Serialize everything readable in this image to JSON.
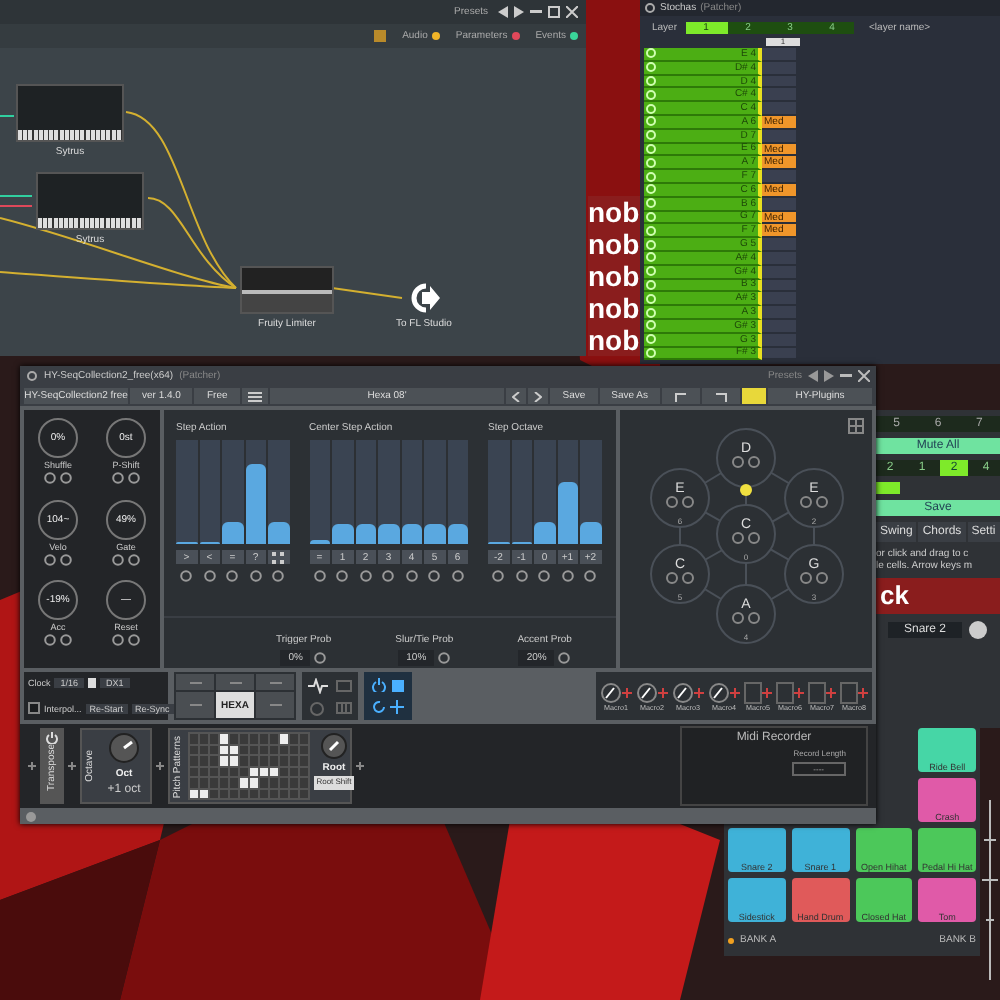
{
  "wallpaper": {
    "side_texts": [
      "nob",
      "nob",
      "nob",
      "nob",
      "nob"
    ]
  },
  "patcher": {
    "presets": "Presets",
    "legend": [
      {
        "label": "Audio",
        "color": "#f0b428"
      },
      {
        "label": "Parameters",
        "color": "#e0485a"
      },
      {
        "label": "Events",
        "color": "#3ad59a"
      }
    ],
    "nodes": [
      {
        "kind": "synth",
        "label": "Sytrus"
      },
      {
        "kind": "synth",
        "label": "Sytrus"
      },
      {
        "kind": "limiter",
        "label": "Fruity Limiter"
      },
      {
        "kind": "output",
        "label": "To FL Studio"
      }
    ]
  },
  "stochas": {
    "title": "Stochas",
    "subtitle": "(Patcher)",
    "layer_label": "Layer",
    "layer_name": "<layer name>",
    "column_header": "1",
    "layers": [
      {
        "label": "1",
        "selected": true
      },
      {
        "label": "2",
        "selected": false
      },
      {
        "label": "3",
        "selected": false
      },
      {
        "label": "4",
        "selected": false
      }
    ],
    "rows": [
      {
        "note": "E 4"
      },
      {
        "note": "D# 4"
      },
      {
        "note": "D 4"
      },
      {
        "note": "C# 4"
      },
      {
        "note": "C 4"
      },
      {
        "note": "A 6",
        "cell": "Med"
      },
      {
        "note": "D 7"
      },
      {
        "note": "E 6",
        "cell": "Med"
      },
      {
        "note": "A 7",
        "cell": "Med"
      },
      {
        "note": "F 7"
      },
      {
        "note": "C 6",
        "cell": "Med"
      },
      {
        "note": "B 6"
      },
      {
        "note": "G 7",
        "cell": "Med"
      },
      {
        "note": "F 7",
        "cell": "Med"
      },
      {
        "note": "G 5"
      },
      {
        "note": "A# 4"
      },
      {
        "note": "G# 4"
      },
      {
        "note": "B 3"
      },
      {
        "note": "A# 3"
      },
      {
        "note": "A 3"
      },
      {
        "note": "G# 3"
      },
      {
        "note": "G 3"
      },
      {
        "note": "F# 3"
      }
    ]
  },
  "drum": {
    "steps": [
      "5",
      "6",
      "7"
    ],
    "mute_all": "Mute All",
    "tabs": [
      {
        "label": "2",
        "selected": false
      },
      {
        "label": "1",
        "selected": false
      },
      {
        "label": "2",
        "selected": true
      },
      {
        "label": "4",
        "selected": false
      }
    ],
    "save": "Save",
    "menu": [
      "Swing",
      "Chords",
      "Setti"
    ],
    "hint": [
      "or click and drag to c",
      "le cells. Arrow keys m"
    ],
    "banner": "ck",
    "sound": "Snare 2",
    "pads": [
      {
        "label": "Ride Bell",
        "color": "#46d6a6"
      },
      {
        "label": "Crash",
        "color": "#e05aa8"
      },
      {
        "label": "Snare 2",
        "color": "#3fb2d8"
      },
      {
        "label": "Snare 1",
        "color": "#3fb2d8"
      },
      {
        "label": "Open Hihat",
        "color": "#4cc85a"
      },
      {
        "label": "Pedal Hi Hat",
        "color": "#4cc85a"
      },
      {
        "label": "Sidestick",
        "color": "#3fb2d8"
      },
      {
        "label": "Hand Drum",
        "color": "#e05a5a"
      },
      {
        "label": "Closed Hat",
        "color": "#4cc85a"
      },
      {
        "label": "Tom",
        "color": "#e05aa8"
      }
    ],
    "bank_a": "BANK A",
    "bank_b": "BANK B"
  },
  "plugin": {
    "title": "HY-SeqCollection2_free(x64)",
    "subtitle": "(Patcher)",
    "presets": "Presets",
    "toolbar": {
      "name": "HY-SeqCollection2 free",
      "version": "ver 1.4.0",
      "license": "Free",
      "preset": "Hexa 08'",
      "save": "Save",
      "save_as": "Save As",
      "brand": "HY-Plugins"
    },
    "knobs": [
      {
        "value": "0%",
        "label": "Shuffle"
      },
      {
        "value": "0st",
        "label": "P-Shift"
      },
      {
        "value": "104~",
        "label": "Velo"
      },
      {
        "value": "49%",
        "label": "Gate"
      },
      {
        "value": "-19%",
        "label": "Acc"
      },
      {
        "value": "—",
        "label": "Reset"
      }
    ],
    "groups": [
      {
        "title": "Step Action",
        "bars": [
          {
            "level": 0,
            "button": ">"
          },
          {
            "level": 0,
            "button": "<"
          },
          {
            "level": 0.22,
            "button": "="
          },
          {
            "level": 0.78,
            "button": "?"
          },
          {
            "level": 0.22,
            "kind": "icon"
          }
        ]
      },
      {
        "title": "Center Step Action",
        "bars": [
          {
            "level": 0.05,
            "button": "="
          },
          {
            "level": 0.2,
            "button": "1"
          },
          {
            "level": 0.2,
            "button": "2"
          },
          {
            "level": 0.2,
            "button": "3"
          },
          {
            "level": 0.2,
            "button": "4"
          },
          {
            "level": 0.2,
            "button": "5"
          },
          {
            "level": 0.2,
            "button": "6"
          }
        ]
      },
      {
        "title": "Step Octave",
        "bars": [
          {
            "level": 0,
            "button": "-2"
          },
          {
            "level": 0,
            "button": "-1"
          },
          {
            "level": 0.22,
            "button": "0"
          },
          {
            "level": 0.6,
            "button": "+1"
          },
          {
            "level": 0.22,
            "button": "+2"
          }
        ]
      }
    ],
    "probs": [
      {
        "label": "Trigger Prob",
        "value": "0%"
      },
      {
        "label": "Slur/Tie Prob",
        "value": "10%"
      },
      {
        "label": "Accent Prob",
        "value": "20%"
      }
    ],
    "hexa": [
      {
        "note": "D",
        "playing": true
      },
      {
        "note": "E",
        "number": "6",
        "playing": false
      },
      {
        "note": "E",
        "number": "2",
        "playing": false
      },
      {
        "note": "C",
        "number": "0",
        "playing": false
      },
      {
        "note": "C",
        "number": "5",
        "playing": false
      },
      {
        "note": "G",
        "number": "3",
        "playing": false
      },
      {
        "note": "A",
        "number": "4",
        "playing": false
      }
    ],
    "clock": {
      "checked": false,
      "label": "Clock",
      "value": "1/16",
      "mode": "DX1",
      "interp": "Interpol...",
      "restart": "Re-Start",
      "resync": "Re-Sync"
    },
    "preset_button": "HEXA",
    "macros": [
      "Macro1",
      "Macro2",
      "Macro3",
      "Macro4"
    ],
    "macro_slots": [
      "Macro5",
      "Macro6",
      "Macro7",
      "Macro8"
    ],
    "devices": {
      "transpose": "Transpose",
      "octave": "Octave",
      "oct_knob": "Oct",
      "oct_value": "+1 oct",
      "patterns": "Pitch Patterns",
      "root": "Root",
      "root_shift": "Root Shift"
    },
    "recorder": {
      "title": "Midi Recorder",
      "length_label": "Record Length",
      "length_value": "----"
    }
  }
}
